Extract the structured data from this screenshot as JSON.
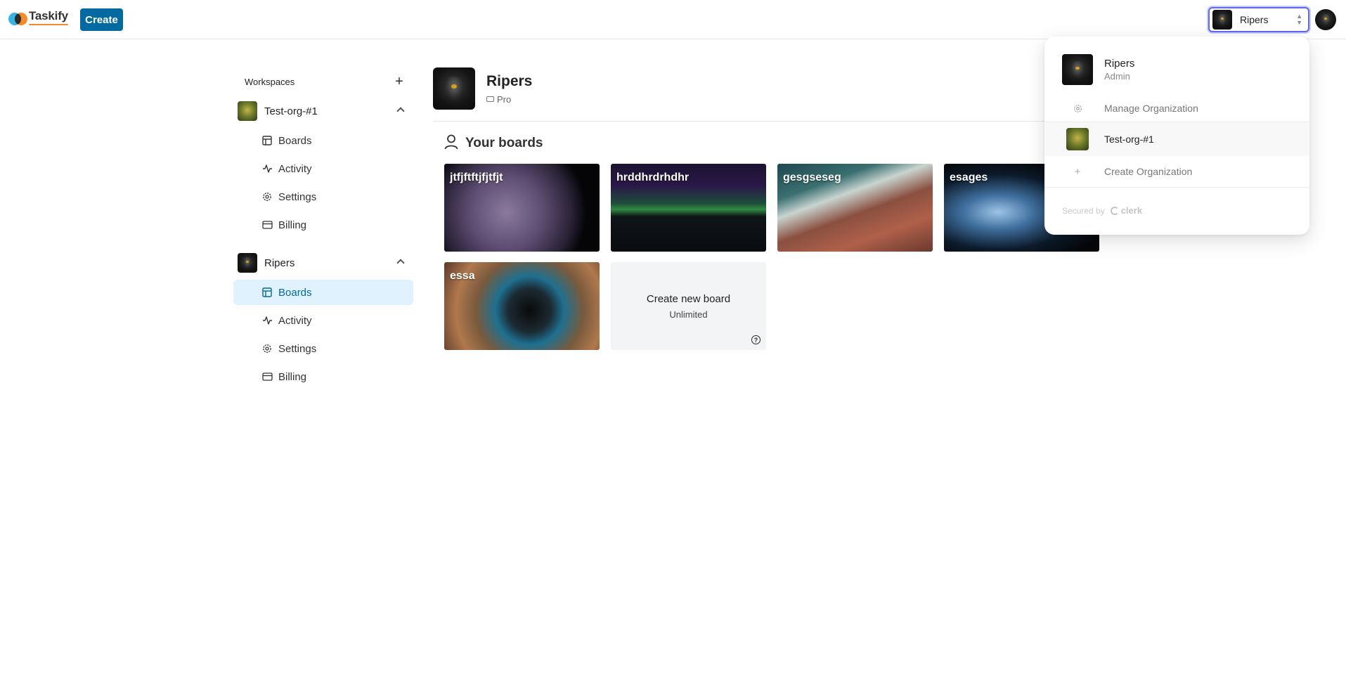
{
  "app": {
    "name": "Taskify"
  },
  "navbar": {
    "create_label": "Create",
    "org_switcher_label": "Ripers"
  },
  "sidebar": {
    "heading": "Workspaces",
    "orgs": [
      {
        "name": "Test-org-#1",
        "items": [
          "Boards",
          "Activity",
          "Settings",
          "Billing"
        ]
      },
      {
        "name": "Ripers",
        "items": [
          "Boards",
          "Activity",
          "Settings",
          "Billing"
        ],
        "active_item": "Boards"
      }
    ]
  },
  "main": {
    "org_name": "Ripers",
    "plan": "Pro",
    "section_title": "Your boards",
    "boards": [
      "jtfjftftjfjtfjt",
      "hrddhrdrhdhr",
      "gesgseseg",
      "esages",
      "essa"
    ],
    "create_board": {
      "title": "Create new board",
      "subtitle": "Unlimited"
    }
  },
  "dropdown": {
    "active_org": {
      "name": "Ripers",
      "role": "Admin"
    },
    "manage_label": "Manage Organization",
    "other_org": "Test-org-#1",
    "create_label": "Create Organization",
    "secured_by": "Secured by",
    "secured_brand": "clerk"
  },
  "colors": {
    "primary": "#0369a1",
    "active_bg": "#e0f2fe",
    "focus_ring": "#6366f1"
  }
}
